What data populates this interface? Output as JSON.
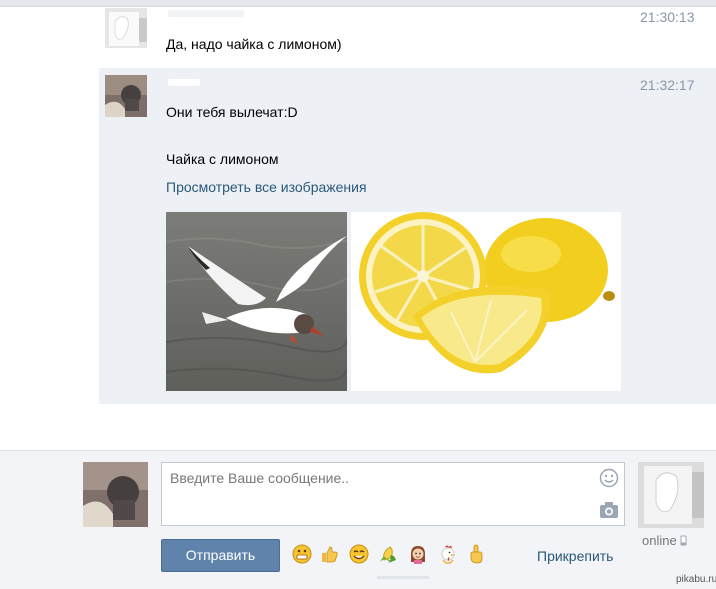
{
  "messages": [
    {
      "time": "21:30:13",
      "text": "Да, надо чайка с лимоном)"
    },
    {
      "time": "21:32:17",
      "text": "Они тебя вылечат:D",
      "attachment_title": "Чайка с лимоном",
      "attachment_link": "Просмотреть все изображения",
      "images": [
        "seagull-photo",
        "lemon-photo"
      ]
    }
  ],
  "composer": {
    "placeholder": "Введите Ваше сообщение..",
    "send_label": "Отправить",
    "attach_label": "Прикрепить",
    "emojis": [
      "grinning-emoji",
      "thumbs-up-emoji",
      "smiling-emoji",
      "corn-emoji",
      "girl-emoji",
      "rooster-emoji",
      "pointing-up-emoji"
    ]
  },
  "contact_status": "online",
  "watermark": "pikabu.ru",
  "colors": {
    "highlight_bg": "#edf1f5",
    "link": "#2b587a",
    "button": "#5f83aa",
    "time": "#8a97a8"
  }
}
